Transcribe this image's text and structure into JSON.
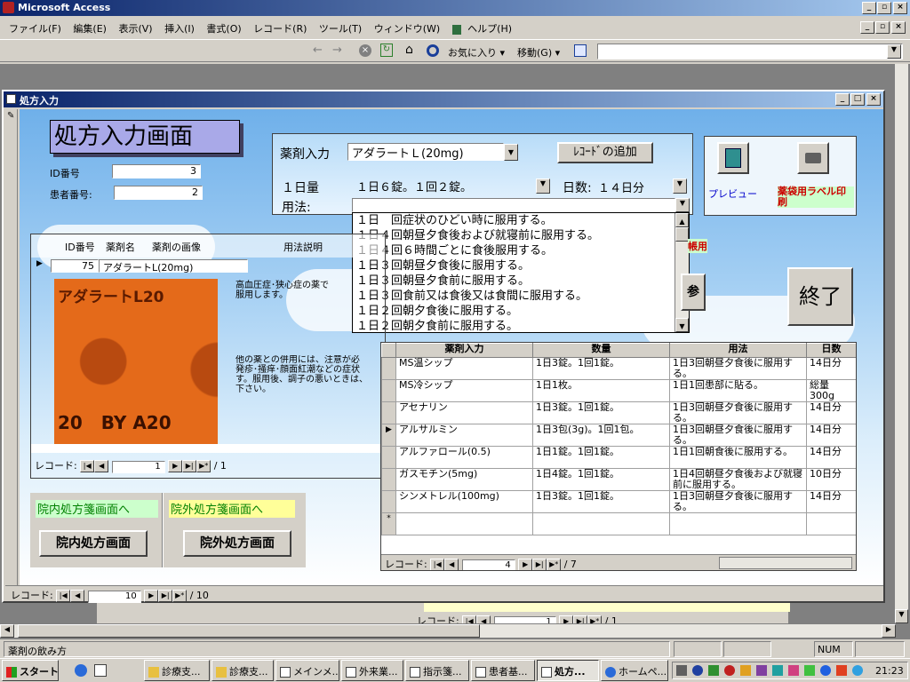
{
  "app": {
    "title": "Microsoft Access"
  },
  "menu": [
    "ファイル(F)",
    "編集(E)",
    "表示(V)",
    "挿入(I)",
    "書式(O)",
    "レコード(R)",
    "ツール(T)",
    "ウィンドウ(W)",
    "ヘルプ(H)"
  ],
  "webbar": {
    "favorites": "お気に入り",
    "goto": "移動(G)"
  },
  "form": {
    "title": "処方入力",
    "heading": "処方入力画面",
    "id_label": "ID番号",
    "id_value": "3",
    "patient_label": "患者番号:",
    "patient_value": "2",
    "drug_label": "薬剤入力",
    "drug_value": "アダラートＬ(20mg)",
    "add_record": "ﾚｺｰﾄﾞの追加",
    "daily_label": "１日量",
    "daily_value": "１日６錠。１回２錠。",
    "days_label": "日数:",
    "days_value": "１４日分",
    "usage_label": "用法:",
    "usage_options": [
      "１日　回症状のひどい時に服用する。",
      "１日４回朝昼夕食後および就寝前に服用する。",
      "１日４回６時間ごとに食後服用する。",
      "１日３回朝昼夕食後に服用する。",
      "１日３回朝昼夕食前に服用する。",
      "１日３回食前又は食後又は食間に服用する。",
      "１日２回朝夕食後に服用する。",
      "１日２回朝夕食前に服用する。"
    ],
    "preview": "プレビュー",
    "label_print": "薬袋用ラベル印刷",
    "notebook": "帳用",
    "exit": "終了",
    "sub_headers": [
      "ID番号",
      "薬剤名",
      "薬剤の画像",
      "用法説明"
    ],
    "sub_id": "75",
    "sub_drug": "アダラートL(20mg)",
    "pill_text": "アダラートL20",
    "pill_code": "20   BY A20",
    "desc1": "高血圧症･狭心症の薬で\n服用します。",
    "desc2": "他の薬との併用には、注意が必\n発疹･掻痒･顔面紅潮などの症状\nす。服用後、調子の悪いときは、\n下さい。",
    "sub_nav": {
      "label": "レコード:",
      "current": "1",
      "total": "/ 1"
    },
    "btn_in_tab": "院内処方箋画面へ",
    "btn_out_tab": "院外処方箋画面へ",
    "btn_in": "院内処方画面",
    "btn_out": "院外処方画面",
    "main_nav": {
      "label": "レコード:",
      "current": "10",
      "total": "/ 10"
    },
    "bottom_nav": {
      "label": "レコード:",
      "current": "1",
      "total": "/ 1"
    }
  },
  "rx_table": {
    "headers": [
      "薬剤入力",
      "数量",
      "用法",
      "日数"
    ],
    "rows": [
      [
        "MS温シップ",
        "1日3錠。1回1錠。",
        "1日3回朝昼夕食後に服用する。",
        "14日分"
      ],
      [
        "MS冷シップ",
        "1日1枚。",
        "1日1回患部に貼る。",
        "総量300g"
      ],
      [
        "アセナリン",
        "1日3錠。1回1錠。",
        "1日3回朝昼夕食後に服用する。",
        "14日分"
      ],
      [
        "アルサルミン",
        "1日3包(3g)。1回1包。",
        "1日3回朝昼夕食後に服用する。",
        "14日分"
      ],
      [
        "アルファロール(0.5)",
        "1日1錠。1回1錠。",
        "1日1回朝食後に服用する。",
        "14日分"
      ],
      [
        "ガスモチン(5mg)",
        "1日4錠。1回1錠。",
        "1日4回朝昼夕食後および就寝前に服用する。",
        "10日分"
      ],
      [
        "シンメトレル(100mg)",
        "1日3錠。1回1錠。",
        "1日3回朝昼夕食後に服用する。",
        "14日分"
      ]
    ],
    "current_row": 3,
    "nav": {
      "label": "レコード:",
      "current": "4",
      "total": "/ 7"
    }
  },
  "status": {
    "text": "薬剤の飲み方",
    "num": "NUM"
  },
  "taskbar": {
    "start": "スタート",
    "tasks": [
      "診療支...",
      "診療支...",
      "メインメ...",
      "外来業...",
      "指示箋...",
      "患者基...",
      "処方...",
      "ホームペ..."
    ],
    "active": 6,
    "clock": "21:23"
  },
  "colors": {
    "titlebar": "#0a246a",
    "heading_bg": "#a9a9e8",
    "label_red": "#cc0000",
    "tab_green": "#ccffcc",
    "tab_yellow": "#ffff99"
  }
}
